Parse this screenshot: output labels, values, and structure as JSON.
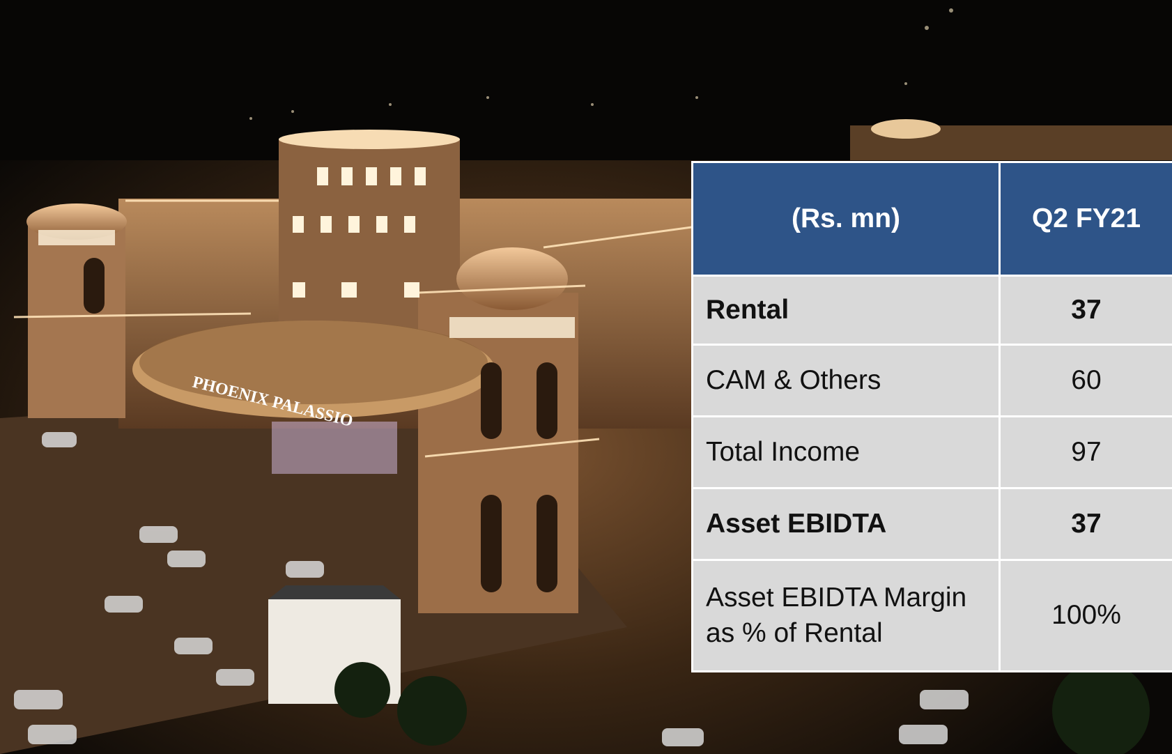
{
  "photo": {
    "description_icon": "night-mall-photo",
    "facade_sign": "PHOENIX PALASSIO"
  },
  "table": {
    "header": {
      "col1": "(Rs. mn)",
      "col2": "Q2 FY21"
    },
    "rows": [
      {
        "label": "Rental",
        "value": "37",
        "bold": true
      },
      {
        "label": "CAM & Others",
        "value": "60",
        "bold": false
      },
      {
        "label": "Total Income",
        "value": "97",
        "bold": false
      },
      {
        "label": "Asset EBIDTA",
        "value": "37",
        "bold": true
      },
      {
        "label_line1": "Asset EBIDTA Margin",
        "label_line2": "as % of Rental",
        "value": "100%",
        "bold": false
      }
    ]
  },
  "colors": {
    "header_bg": "#2e5488",
    "row_bg": "#d9d9d9",
    "border": "#ffffff"
  }
}
